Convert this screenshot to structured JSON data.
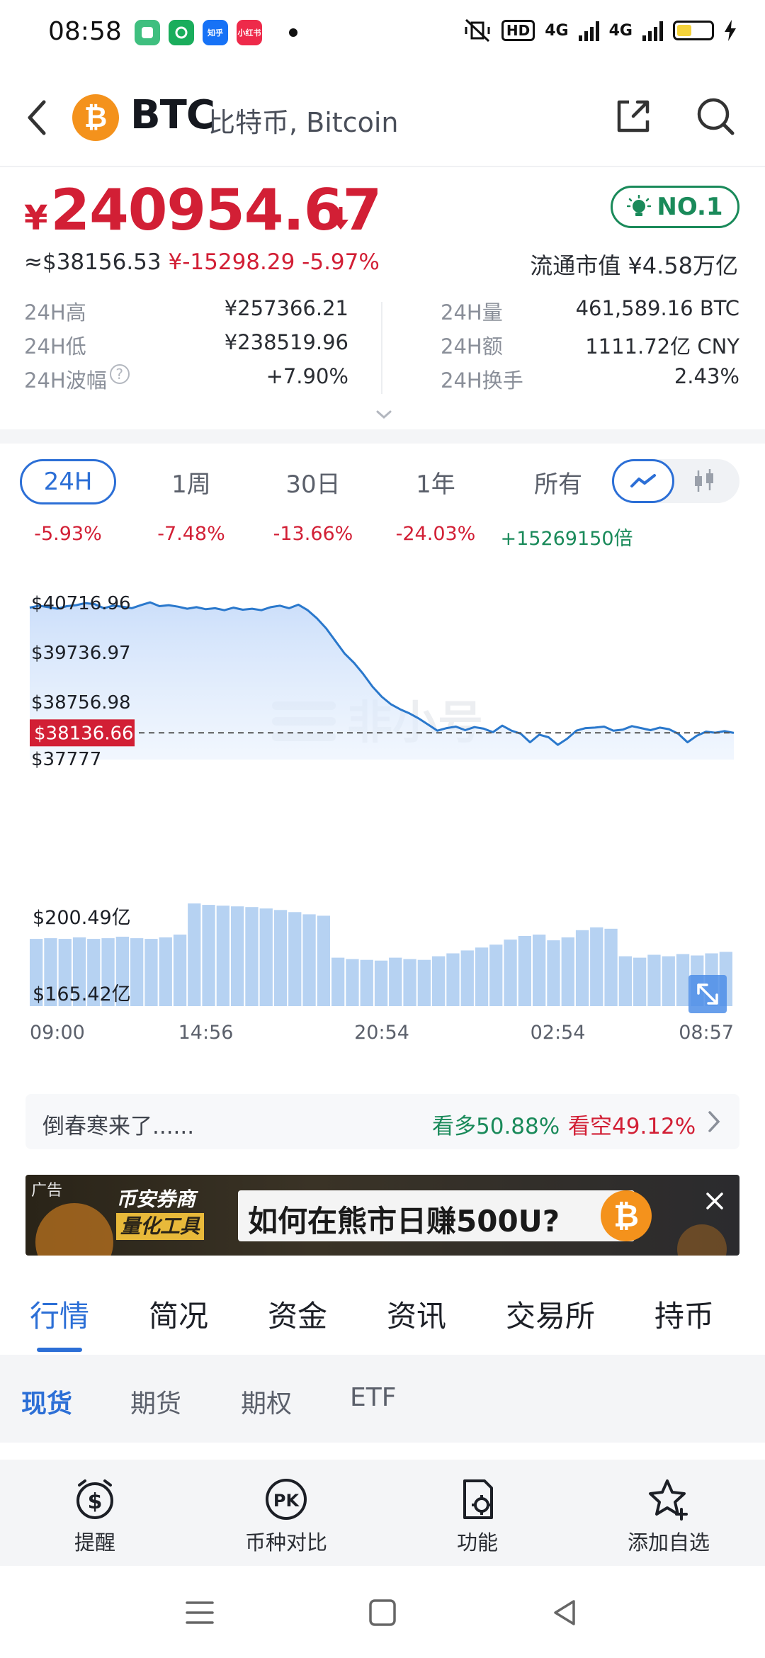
{
  "status_bar": {
    "time": "08:58",
    "apps": [
      {
        "name": "app-green-icon",
        "color": "#3fbf7f",
        "label": ""
      },
      {
        "name": "app-wechat-icon",
        "color": "#1aad5c",
        "label": ""
      },
      {
        "name": "zhihu-icon",
        "color": "#1772f6",
        "label": "知乎"
      },
      {
        "name": "xiaohongshu-icon",
        "color": "#ee2a4a",
        "label": "小红书"
      }
    ],
    "hd_label": "HD",
    "net1": "4G",
    "net2": "4G"
  },
  "header": {
    "symbol": "BTC",
    "name": "比特币, Bitcoin",
    "logo_glyph": "₿"
  },
  "price": {
    "currency": "¥",
    "value": "240954.67",
    "usd": "≈$38156.53",
    "change": "¥-15298.29 -5.97%",
    "rank": "NO.1",
    "market_cap": "流通市值  ¥4.58万亿"
  },
  "stats": [
    {
      "label": "24H高",
      "value": "¥257366.21"
    },
    {
      "label": "24H低",
      "value": "¥238519.96"
    },
    {
      "label": "24H波幅",
      "value": "+7.90%",
      "help": "?"
    },
    {
      "label": "24H量",
      "value": "461,589.16 BTC"
    },
    {
      "label": "24H额",
      "value": "1111.72亿 CNY"
    },
    {
      "label": "24H换手",
      "value": "2.43%"
    }
  ],
  "range_tabs": [
    {
      "label": "24H",
      "change": "-5.93%",
      "active": true
    },
    {
      "label": "1周",
      "change": "-7.48%"
    },
    {
      "label": "30日",
      "change": "-13.66%"
    },
    {
      "label": "1年",
      "change": "-24.03%"
    },
    {
      "label": "所有",
      "change": "+15269150倍"
    }
  ],
  "colors": {
    "up": "#1a8a5a",
    "down": "#d21f35",
    "accent": "#2c6fd6",
    "line": "#2a78cc",
    "area": "#cfe2fb",
    "volume": "#9ec3ee"
  },
  "chart_data": {
    "type": "line",
    "title": "",
    "price_axis": {
      "ticks": [
        "$40716.96",
        "$39736.97",
        "$38756.98",
        "$37777"
      ],
      "tick_values": [
        40716.96,
        39736.97,
        38756.98,
        37777
      ],
      "ylim": [
        37777,
        40716.96
      ]
    },
    "current_price_label": "$38136.66",
    "current_price": 38136.66,
    "watermark": "非小号",
    "x_ticks": [
      "09:00",
      "14:56",
      "20:54",
      "02:54",
      "08:57"
    ],
    "price_series": [
      40610,
      40650,
      40620,
      40590,
      40640,
      40660,
      40700,
      40680,
      40600,
      40650,
      40630,
      40600,
      40660,
      40716,
      40640,
      40660,
      40630,
      40590,
      40620,
      40580,
      40600,
      40560,
      40610,
      40570,
      40590,
      40560,
      40620,
      40650,
      40600,
      40670,
      40560,
      40400,
      40200,
      39950,
      39700,
      39520,
      39300,
      39050,
      38850,
      38700,
      38600,
      38520,
      38420,
      38300,
      38180,
      38230,
      38260,
      38190,
      38250,
      38220,
      38150,
      38280,
      38180,
      38120,
      37950,
      38100,
      38050,
      37900,
      38020,
      38180,
      38230,
      38240,
      38260,
      38180,
      38200,
      38270,
      38230,
      38190,
      38240,
      38210,
      38120,
      37950,
      38080,
      38160,
      38140,
      38170,
      38136
    ],
    "volume_axis": {
      "ticks": [
        "$200.49亿",
        "$165.42亿"
      ]
    },
    "volume_series": [
      0.46,
      0.47,
      0.46,
      0.48,
      0.46,
      0.47,
      0.49,
      0.47,
      0.46,
      0.48,
      0.52,
      0.95,
      0.93,
      0.92,
      0.91,
      0.9,
      0.88,
      0.86,
      0.83,
      0.8,
      0.78,
      0.2,
      0.18,
      0.17,
      0.16,
      0.2,
      0.18,
      0.17,
      0.22,
      0.26,
      0.3,
      0.34,
      0.38,
      0.45,
      0.5,
      0.52,
      0.44,
      0.48,
      0.58,
      0.62,
      0.6,
      0.22,
      0.2,
      0.24,
      0.22,
      0.25,
      0.23,
      0.26,
      0.28
    ]
  },
  "sentiment": {
    "text": "倒春寒来了......",
    "bull": "看多50.88%",
    "bear": "看空49.12%"
  },
  "ad": {
    "tag": "广告",
    "brand_line1": "币安券商",
    "brand_line2": "量化工具",
    "headline": "如何在熊市日赚500U?"
  },
  "main_tabs": [
    "行情",
    "简况",
    "资金",
    "资讯",
    "交易所",
    "持币"
  ],
  "sub_tabs": [
    "现货",
    "期货",
    "期权",
    "ETF"
  ],
  "actions": [
    "提醒",
    "币种对比",
    "功能",
    "添加自选"
  ]
}
